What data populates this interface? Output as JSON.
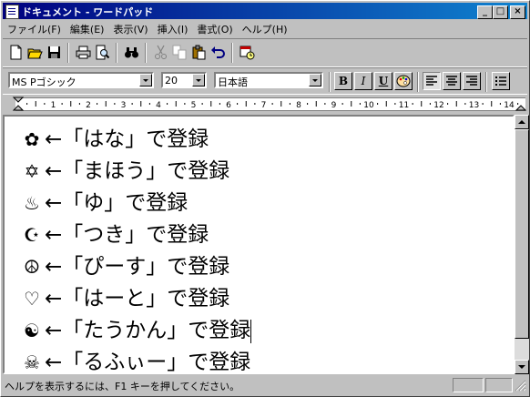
{
  "window": {
    "title": "ドキュメント - ワードパッド",
    "controls": {
      "minimize": "_",
      "maximize": "□",
      "close": "×"
    }
  },
  "menubar": {
    "items": [
      "ファイル(F)",
      "編集(E)",
      "表示(V)",
      "挿入(I)",
      "書式(O)",
      "ヘルプ(H)"
    ]
  },
  "toolbar": {
    "buttons": [
      "new-document-icon",
      "open-folder-icon",
      "save-disk-icon",
      "print-icon",
      "print-preview-icon",
      "find-binoculars-icon",
      "cut-scissors-icon",
      "copy-icon",
      "paste-icon",
      "undo-icon",
      "insert-datetime-icon"
    ]
  },
  "format": {
    "font": "MS Pゴシック",
    "size": "20",
    "script": "日本語",
    "bold": "B",
    "italic": "I",
    "underline": "U"
  },
  "ruler": {
    "labels": [
      "1",
      "2",
      "3",
      "4",
      "5",
      "6",
      "7",
      "8",
      "9",
      "10",
      "11",
      "12",
      "13",
      "14"
    ]
  },
  "document": {
    "lines": [
      {
        "sym": "✿",
        "text": "←「はな」で登録"
      },
      {
        "sym": "✡",
        "text": "←「まほう」で登録"
      },
      {
        "sym": "♨",
        "text": "←「ゆ」で登録"
      },
      {
        "sym": "☪",
        "text": "←「つき」で登録"
      },
      {
        "sym": "☮",
        "text": "←「ぴーす」で登録"
      },
      {
        "sym": "♡",
        "text": "←「はーと」で登録"
      },
      {
        "sym": "☯",
        "text": "←「たうかん」で登録"
      },
      {
        "sym": "☠",
        "text": "←「るふぃー」で登録"
      }
    ]
  },
  "statusbar": {
    "help_text": "ヘルプを表示するには、F1 キーを押してください。"
  },
  "colors": {
    "titlebar": "#000080",
    "face": "#c0c0c0"
  }
}
